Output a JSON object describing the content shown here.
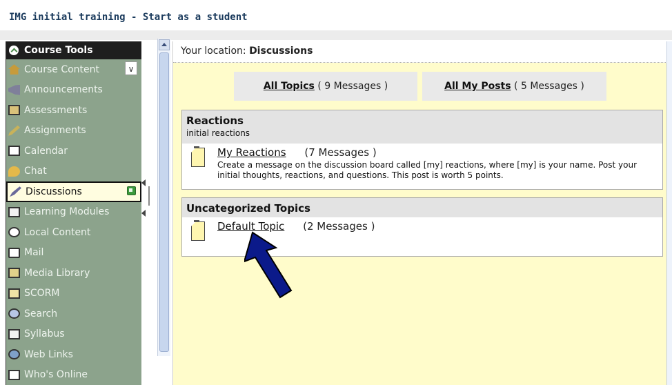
{
  "window": {
    "title": "IMG initial training - Start as a student"
  },
  "sidebar": {
    "header": "Course Tools",
    "items": [
      {
        "label": "Course Content",
        "icon": "house-icon"
      },
      {
        "label": "Announcements",
        "icon": "megaphone-icon"
      },
      {
        "label": "Assessments",
        "icon": "clipboard-icon"
      },
      {
        "label": "Assignments",
        "icon": "pen-icon"
      },
      {
        "label": "Calendar",
        "icon": "calendar-icon"
      },
      {
        "label": "Chat",
        "icon": "chat-icon"
      },
      {
        "label": "Discussions",
        "icon": "discussion-icon"
      },
      {
        "label": "Learning Modules",
        "icon": "document-icon"
      },
      {
        "label": "Local Content",
        "icon": "disc-icon"
      },
      {
        "label": "Mail",
        "icon": "mail-icon"
      },
      {
        "label": "Media Library",
        "icon": "media-icon"
      },
      {
        "label": "SCORM",
        "icon": "scorm-icon"
      },
      {
        "label": "Search",
        "icon": "search-icon"
      },
      {
        "label": "Syllabus",
        "icon": "book-icon"
      },
      {
        "label": "Web Links",
        "icon": "globe-icon"
      },
      {
        "label": "Who's Online",
        "icon": "people-icon"
      }
    ]
  },
  "location": {
    "label": "Your location:",
    "value": "Discussions"
  },
  "tabs": {
    "all_topics": {
      "label": "All Topics",
      "count": "( 9 Messages )"
    },
    "all_my_posts": {
      "label": "All My Posts",
      "count": "( 5 Messages )"
    }
  },
  "categories": [
    {
      "name": "Reactions",
      "description": "initial reactions",
      "topics": [
        {
          "title": "My Reactions",
          "count": "(7 Messages )",
          "description": "Create a message on the discussion board called [my] reactions, where [my] is your name. Post your initial thoughts, reactions, and questions. This post is worth 5 points."
        }
      ]
    },
    {
      "name": "Uncategorized Topics",
      "topics": [
        {
          "title": "Default Topic",
          "count": "(2 Messages )"
        }
      ]
    }
  ],
  "colors": {
    "sidebar_bg": "#8ca38c",
    "content_bg": "#fffccb",
    "title_text": "#1a3a5c",
    "arrow": "#0b1a8a"
  }
}
